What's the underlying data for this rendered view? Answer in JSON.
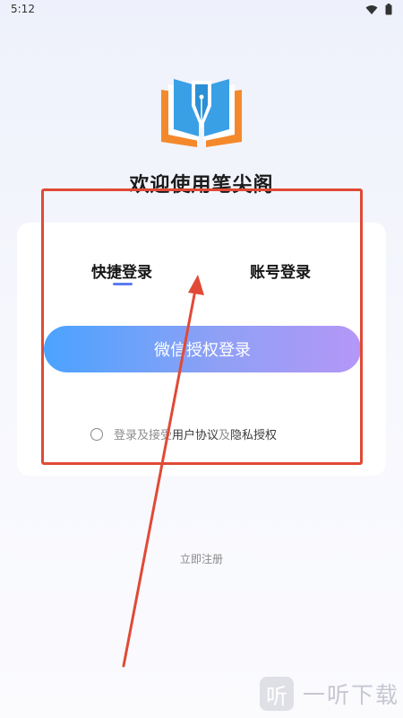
{
  "status_bar": {
    "time": "5:12"
  },
  "app": {
    "title": "欢迎使用笔尖阁"
  },
  "tabs": [
    {
      "label": "快捷登录",
      "active": true
    },
    {
      "label": "账号登录",
      "active": false
    }
  ],
  "login": {
    "wechat_button_label": "微信授权登录"
  },
  "agreement": {
    "prefix": "登录及接受",
    "user_agreement": "用户协议",
    "and": "及",
    "privacy": "隐私授权",
    "checked": false
  },
  "register": {
    "label": "立即注册"
  },
  "watermark": {
    "badge": "听",
    "text": "一听下载"
  },
  "colors": {
    "accent": "#5b7cf0",
    "button_start": "#4aa3ff",
    "button_end": "#b497f7",
    "annotation": "#e04a36",
    "logo_orange": "#f4892c",
    "logo_blue": "#3aa0e6"
  }
}
